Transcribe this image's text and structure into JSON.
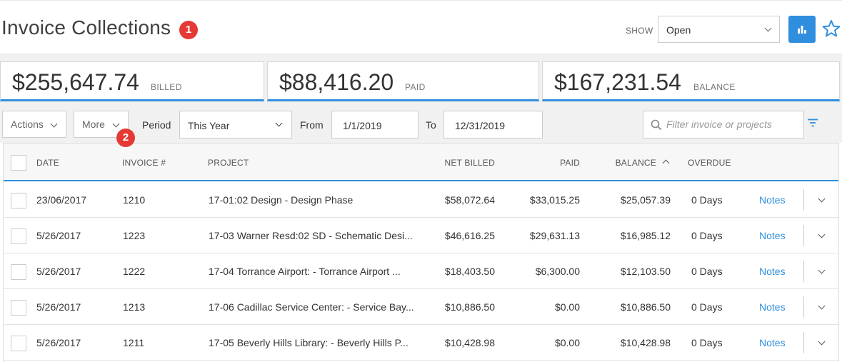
{
  "header": {
    "title": "Invoice Collections",
    "title_badge": "1",
    "show_label": "SHOW",
    "show_value": "Open",
    "chart_icon": "bar-chart-icon",
    "favorite_icon": "star-icon",
    "accent_color": "#2f8fde",
    "badge_color": "#e53935"
  },
  "summary": {
    "billed_amount": "$255,647.74",
    "billed_label": "BILLED",
    "paid_amount": "$88,416.20",
    "paid_label": "PAID",
    "balance_amount": "$167,231.54",
    "balance_label": "BALANCE"
  },
  "filters": {
    "actions_label": "Actions",
    "more_label": "More",
    "more_badge": "2",
    "period_label": "Period",
    "period_value": "This Year",
    "from_label": "From",
    "from_value": "1/1/2019",
    "to_label": "To",
    "to_value": "12/31/2019",
    "search_placeholder": "Filter invoice or projects"
  },
  "table": {
    "columns": {
      "date": "DATE",
      "invoice": "INVOICE #",
      "project": "PROJECT",
      "net_billed": "NET BILLED",
      "paid": "PAID",
      "balance": "BALANCE",
      "overdue": "OVERDUE"
    },
    "sorted_by": "balance",
    "rows": [
      {
        "date": "23/06/2017",
        "invoice": "1210",
        "project": "17-01:02 Design - Design Phase",
        "net_billed": "$58,072.64",
        "paid": "$33,015.25",
        "balance": "$25,057.39",
        "overdue": "0 Days",
        "notes": "Notes"
      },
      {
        "date": "5/26/2017",
        "invoice": "1223",
        "project": "17-03 Warner Resd:02 SD - Schematic Desi...",
        "net_billed": "$46,616.25",
        "paid": "$29,631.13",
        "balance": "$16,985.12",
        "overdue": "0 Days",
        "notes": "Notes"
      },
      {
        "date": "5/26/2017",
        "invoice": "1222",
        "project": "17-04 Torrance Airport: - Torrance Airport ...",
        "net_billed": "$18,403.50",
        "paid": "$6,300.00",
        "balance": "$12,103.50",
        "overdue": "0 Days",
        "notes": "Notes"
      },
      {
        "date": "5/26/2017",
        "invoice": "1213",
        "project": "17-06 Cadillac Service Center: - Service Bay...",
        "net_billed": "$10,886.50",
        "paid": "$0.00",
        "balance": "$10,886.50",
        "overdue": "0 Days",
        "notes": "Notes"
      },
      {
        "date": "5/26/2017",
        "invoice": "1211",
        "project": "17-05 Beverly Hills Library: - Beverly Hills P...",
        "net_billed": "$10,428.98",
        "paid": "$0.00",
        "balance": "$10,428.98",
        "overdue": "0 Days",
        "notes": "Notes"
      }
    ]
  }
}
